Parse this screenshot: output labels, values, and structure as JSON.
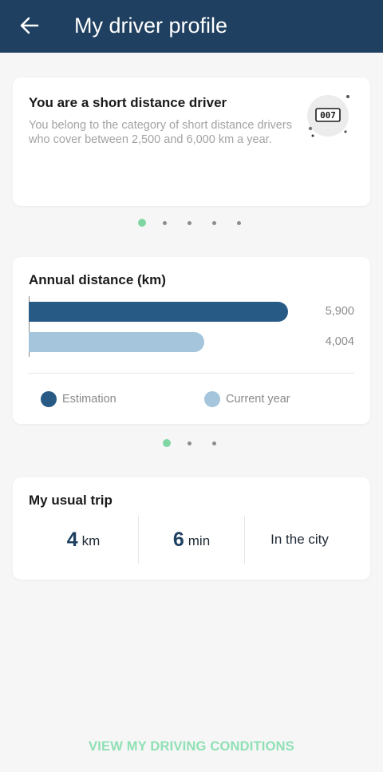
{
  "appbar": {
    "title": "My driver profile",
    "back_icon": "arrow-left-icon"
  },
  "profile_card": {
    "title": "You are a short distance driver",
    "description": "You belong to the category of short distance drivers who cover between 2,500 and 6,000 km a year.",
    "badge_icon": "odometer-icon",
    "badge_text": "007"
  },
  "carousel1": {
    "count": 5,
    "active": 0
  },
  "distance_card": {
    "title": "Annual distance (km)",
    "chart_data": {
      "type": "bar",
      "orientation": "horizontal",
      "series": [
        {
          "name": "Estimation",
          "value": 5900,
          "label": "5,900",
          "color": "#275a85"
        },
        {
          "name": "Current year",
          "value": 4004,
          "label": "4,004",
          "color": "#a5c5dc"
        }
      ],
      "xlim": [
        0,
        6400
      ],
      "legend_position": "bottom"
    },
    "legend": {
      "estimation": "Estimation",
      "current_year": "Current year"
    }
  },
  "carousel2": {
    "count": 3,
    "active": 0
  },
  "trip_card": {
    "title": "My usual trip",
    "distance_value": "4",
    "distance_unit": "km",
    "duration_value": "6",
    "duration_unit": "min",
    "area": "In the city"
  },
  "cta": {
    "label": "VIEW MY DRIVING CONDITIONS"
  },
  "colors": {
    "appbar": "#1f4060",
    "accent_green": "#7fd6a3",
    "bar_dark": "#275a85",
    "bar_light": "#a5c5dc"
  }
}
